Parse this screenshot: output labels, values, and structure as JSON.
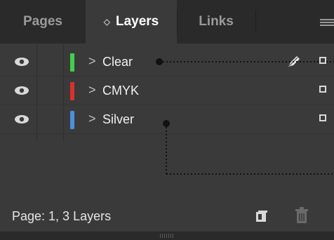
{
  "tabs": {
    "pages": "Pages",
    "layers": "Layers",
    "links": "Links"
  },
  "layers": [
    {
      "name": "Clear",
      "color": "#3fd14a",
      "arrow": ">"
    },
    {
      "name": "CMYK",
      "color": "#d8312c",
      "arrow": ">"
    },
    {
      "name": "Silver",
      "color": "#4a8fe0",
      "arrow": ">"
    }
  ],
  "footer": {
    "status": "Page: 1, 3 Layers"
  },
  "icons": {
    "visibility": "eye-icon",
    "expand": "chevron-right-icon",
    "pen": "pen-icon",
    "new_layer": "new-layer-icon",
    "delete": "trash-icon",
    "menu": "panel-menu-icon"
  }
}
